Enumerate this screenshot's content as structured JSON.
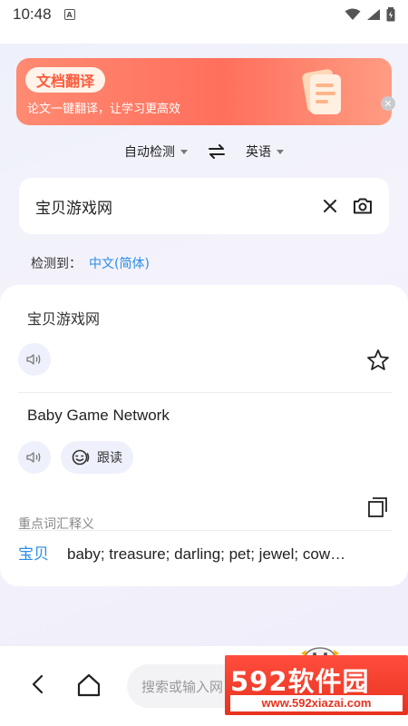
{
  "status_bar": {
    "time": "10:48",
    "notification_icon": "A"
  },
  "banner": {
    "title": "文档翻译",
    "subtitle": "论文一键翻译，让学习更高效"
  },
  "languages": {
    "source": "自动检测",
    "target": "英语"
  },
  "input": {
    "text": "宝贝游戏网"
  },
  "detection": {
    "label": "检测到：",
    "value": "中文(简体)"
  },
  "result": {
    "source_text": "宝贝游戏网",
    "translation": "Baby Game Network",
    "follow_read_label": "跟读"
  },
  "vocabulary": {
    "title": "重点词汇释义",
    "items": [
      {
        "word": "宝贝",
        "definition": "baby; treasure; darling; pet; jewel; cow…"
      }
    ]
  },
  "nav": {
    "search_placeholder": "搜索或输入网"
  },
  "watermark": {
    "brand": "592软件园",
    "url": "www.592xiazai.com"
  },
  "colors": {
    "accent": "#2b8de6",
    "banner": "#ff6f5c",
    "watermark": "#e8321f"
  }
}
